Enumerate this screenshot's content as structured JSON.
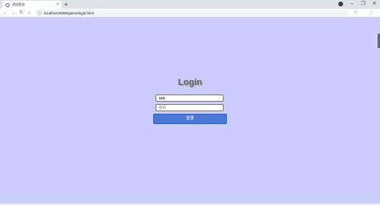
{
  "tab": {
    "title": "游戏登录",
    "close_glyph": "×",
    "new_tab_glyph": "+"
  },
  "window": {
    "minimize": "–",
    "restore": "❐",
    "close": "✕"
  },
  "toolbar": {
    "back": "←",
    "forward": "→",
    "reload": "↻",
    "home": "⌂",
    "url": "localhost:8080/game/login.html",
    "info_glyph": "ⓘ",
    "star_glyph": "☆",
    "menu_glyph": "⋮"
  },
  "login": {
    "title": "Login",
    "username_value": "123",
    "password_placeholder": "密码",
    "submit_label": "登录"
  },
  "colors": {
    "page_background": "#ccccff",
    "button_background": "#4a77d4"
  },
  "icons": {
    "favicon": "globe-icon",
    "profile": "profile-icon"
  }
}
